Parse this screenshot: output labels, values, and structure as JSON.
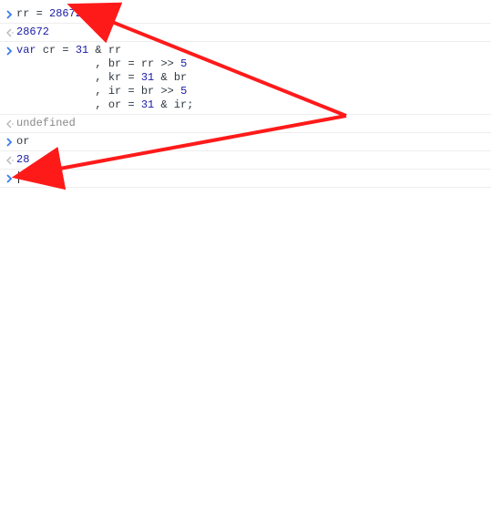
{
  "console": {
    "entries": [
      {
        "kind": "input",
        "parts": [
          {
            "t": "id",
            "v": "rr "
          },
          {
            "t": "op",
            "v": "= "
          },
          {
            "t": "num",
            "v": "28672"
          }
        ]
      },
      {
        "kind": "output",
        "parts": [
          {
            "t": "num",
            "v": "28672"
          }
        ]
      },
      {
        "kind": "input",
        "multiline": true,
        "parts": [
          {
            "t": "kw",
            "v": "var "
          },
          {
            "t": "id",
            "v": "cr "
          },
          {
            "t": "op",
            "v": "= "
          },
          {
            "t": "num",
            "v": "31"
          },
          {
            "t": "op",
            "v": " & "
          },
          {
            "t": "id",
            "v": "rr"
          },
          {
            "t": "raw",
            "v": "\n            , "
          },
          {
            "t": "id",
            "v": "br "
          },
          {
            "t": "op",
            "v": "= "
          },
          {
            "t": "id",
            "v": "rr "
          },
          {
            "t": "op",
            "v": ">> "
          },
          {
            "t": "num",
            "v": "5"
          },
          {
            "t": "raw",
            "v": "\n            , "
          },
          {
            "t": "id",
            "v": "kr "
          },
          {
            "t": "op",
            "v": "= "
          },
          {
            "t": "num",
            "v": "31"
          },
          {
            "t": "op",
            "v": " & "
          },
          {
            "t": "id",
            "v": "br"
          },
          {
            "t": "raw",
            "v": "\n            , "
          },
          {
            "t": "id",
            "v": "ir "
          },
          {
            "t": "op",
            "v": "= "
          },
          {
            "t": "id",
            "v": "br "
          },
          {
            "t": "op",
            "v": ">> "
          },
          {
            "t": "num",
            "v": "5"
          },
          {
            "t": "raw",
            "v": "\n            , "
          },
          {
            "t": "id",
            "v": "or "
          },
          {
            "t": "op",
            "v": "= "
          },
          {
            "t": "num",
            "v": "31"
          },
          {
            "t": "op",
            "v": " & "
          },
          {
            "t": "id",
            "v": "ir"
          },
          {
            "t": "op",
            "v": ";"
          }
        ]
      },
      {
        "kind": "output",
        "parts": [
          {
            "t": "undef",
            "v": "undefined"
          }
        ]
      },
      {
        "kind": "input",
        "parts": [
          {
            "t": "id",
            "v": "or"
          }
        ]
      },
      {
        "kind": "output",
        "parts": [
          {
            "t": "num",
            "v": "28"
          }
        ]
      },
      {
        "kind": "input",
        "cursor": true,
        "parts": []
      }
    ]
  },
  "icons": {
    "input_arrow": "❯",
    "output_arrow": "❮"
  },
  "annotation": {
    "color": "#ff1a1a"
  }
}
